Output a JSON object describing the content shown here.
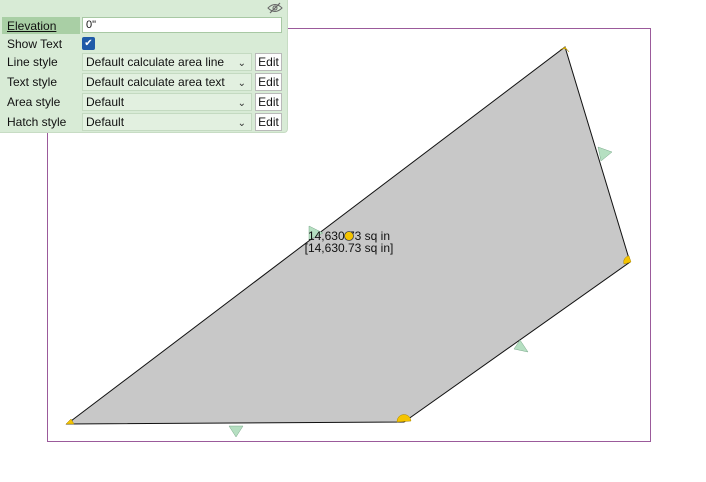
{
  "drawing": {
    "area_text_primary": "14,630.73 sq in",
    "area_text_secondary": "[14,630.73 sq in]",
    "area_fill_color": "#c8c8c8",
    "frame_color": "#8a4a8a",
    "vertex_handle_color": "#f5c400",
    "midpoint_handle_color": "#b5dfc1"
  },
  "panel": {
    "background_color": "#d8ebd6",
    "hide_icon": "eye-slash-icon",
    "elevation": {
      "label": "Elevation",
      "value": "0\""
    },
    "show_text": {
      "label": "Show Text",
      "checked": true
    },
    "line_style": {
      "label": "Line style",
      "value": "Default calculate area line",
      "edit": "Edit"
    },
    "text_style": {
      "label": "Text style",
      "value": "Default calculate area text",
      "edit": "Edit"
    },
    "area_style": {
      "label": "Area style",
      "value": "Default",
      "edit": "Edit"
    },
    "hatch_style": {
      "label": "Hatch style",
      "value": "Default",
      "edit": "Edit"
    }
  }
}
